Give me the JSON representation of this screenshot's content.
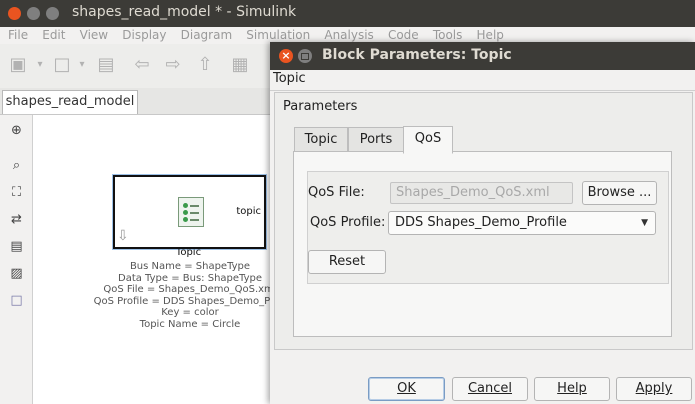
{
  "window": {
    "title": "shapes_read_model * - Simulink",
    "menu": [
      "File",
      "Edit",
      "View",
      "Display",
      "Diagram",
      "Simulation",
      "Analysis",
      "Code",
      "Tools",
      "Help"
    ],
    "model_tab": "shapes_read_model"
  },
  "block": {
    "port_label": "topic",
    "name": "Topic",
    "annotations": [
      "Bus Name = ShapeType",
      "Data Type = Bus: ShapeType",
      "QoS File = Shapes_Demo_QoS.xml",
      "QoS Profile = DDS Shapes_Demo_Profi",
      "Key = color",
      "Topic Name = Circle"
    ]
  },
  "dialog": {
    "title": "Block Parameters: Topic",
    "header": "Topic",
    "group_label": "Parameters",
    "tabs": [
      "Topic",
      "Ports",
      "QoS"
    ],
    "active_tab": "QoS",
    "qos_file": {
      "label": "QoS File:",
      "value": "Shapes_Demo_QoS.xml",
      "browse_label": "Browse ..."
    },
    "qos_profile": {
      "label": "QoS Profile:",
      "selected": "DDS Shapes_Demo_Profile"
    },
    "reset_label": "Reset",
    "buttons": {
      "ok": "OK",
      "cancel": "Cancel",
      "help": "Help",
      "apply": "Apply"
    }
  },
  "colors": {
    "titlebar": "#3c3b37",
    "close_button": "#e95420"
  },
  "icons": [
    "close-icon",
    "minimize-icon",
    "maximize-icon",
    "new-model-icon",
    "open-icon",
    "save-icon",
    "back-icon",
    "forward-icon",
    "up-icon",
    "library-icon",
    "zoom-icon",
    "fit-icon",
    "route-icon",
    "annotation-icon",
    "image-icon",
    "area-icon",
    "chevron-down-icon"
  ]
}
